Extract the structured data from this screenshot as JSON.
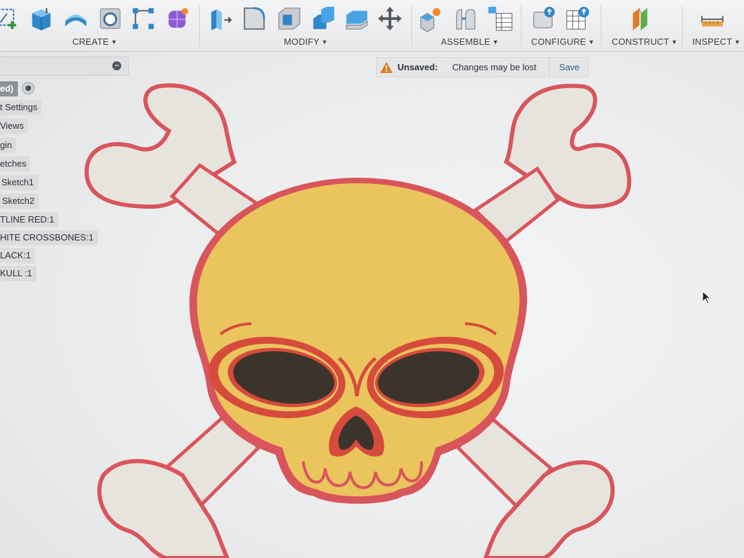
{
  "toolbar": {
    "groups": [
      {
        "label": "CREATE"
      },
      {
        "label": "MODIFY"
      },
      {
        "label": "ASSEMBLE"
      },
      {
        "label": "CONFIGURE"
      },
      {
        "label": "CONSTRUCT"
      },
      {
        "label": "INSPECT"
      }
    ],
    "icons": {
      "create": [
        "create-sketch-icon",
        "extrude-icon",
        "revolve-icon",
        "hole-icon",
        "pattern-icon",
        "form-icon"
      ],
      "modify": [
        "press-pull-icon",
        "fillet-icon",
        "shell-icon",
        "combine-icon",
        "offset-face-icon",
        "move-icon"
      ],
      "assemble": [
        "new-component-icon",
        "joint-icon",
        "bill-of-materials-icon"
      ],
      "configure": [
        "configure-parameters-icon",
        "configure-table-icon"
      ],
      "construct": [
        "offset-plane-icon"
      ],
      "inspect": [
        "measure-icon"
      ]
    }
  },
  "browser": {
    "items": [
      {
        "label": "ed)"
      },
      {
        "label": "t Settings"
      },
      {
        "label": "Views"
      },
      {
        "label": "gin"
      },
      {
        "label": "etches"
      },
      {
        "label": "Sketch1"
      },
      {
        "label": "Sketch2"
      },
      {
        "label": "TLINE RED:1"
      },
      {
        "label": "HITE CROSSBONES:1"
      },
      {
        "label": "LACK:1"
      },
      {
        "label": "KULL :1"
      }
    ]
  },
  "status": {
    "label": "Unsaved:",
    "message": "Changes may be lost",
    "save_label": "Save"
  },
  "colors": {
    "outline_red": "#d8555c",
    "bone_white": "#e6e4dd",
    "skull_yellow": "#eac45d",
    "eye_black": "#3b342b",
    "inner_red": "#d64b3c",
    "warning_orange": "#e07b23"
  }
}
